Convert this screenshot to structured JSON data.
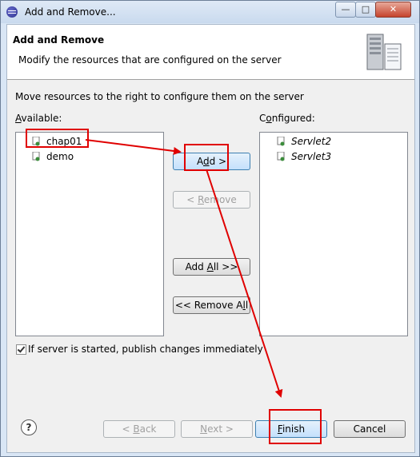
{
  "window": {
    "title": "Add and Remove...",
    "minimize_symbol": "—",
    "maximize_symbol": "□",
    "close_symbol": "✕"
  },
  "header": {
    "title": "Add and Remove",
    "description": "Modify the resources that are configured on the server"
  },
  "main": {
    "description": "Move resources to the right to configure them on the server",
    "available_label_mnemonic": "A",
    "available_label_rest": "vailable:",
    "configured_label_pre": "C",
    "configured_label_mnemonic": "o",
    "configured_label_rest": "nfigured:",
    "available_items": [
      {
        "label": "chap01",
        "icon": "web-project-icon",
        "selected": true
      },
      {
        "label": "demo",
        "icon": "web-project-icon",
        "selected": false
      }
    ],
    "configured_items": [
      {
        "label": "Servlet2",
        "icon": "web-project-icon"
      },
      {
        "label": "Servlet3",
        "icon": "web-project-icon"
      }
    ]
  },
  "buttons": {
    "add_pre": "A",
    "add_mnemonic": "d",
    "add_rest": "d >",
    "remove_pre": "< ",
    "remove_mnemonic": "R",
    "remove_rest": "emove",
    "add_all_pre": "Add ",
    "add_all_mnemonic": "A",
    "add_all_rest": "ll >>",
    "remove_all_pre": "<< Remove A",
    "remove_all_mnemonic": "l",
    "remove_all_rest": "l",
    "back_pre": "< ",
    "back_mnemonic": "B",
    "back_rest": "ack",
    "next_mnemonic": "N",
    "next_rest": "ext >",
    "finish_mnemonic": "F",
    "finish_rest": "inish",
    "cancel": "Cancel"
  },
  "options": {
    "publish_checkbox_label": "If server is started, publish changes immediately",
    "publish_checked": true
  },
  "help": {
    "symbol": "?"
  },
  "colors": {
    "annotation_red": "#e00000",
    "focus_blue": "#3c7fb1"
  }
}
